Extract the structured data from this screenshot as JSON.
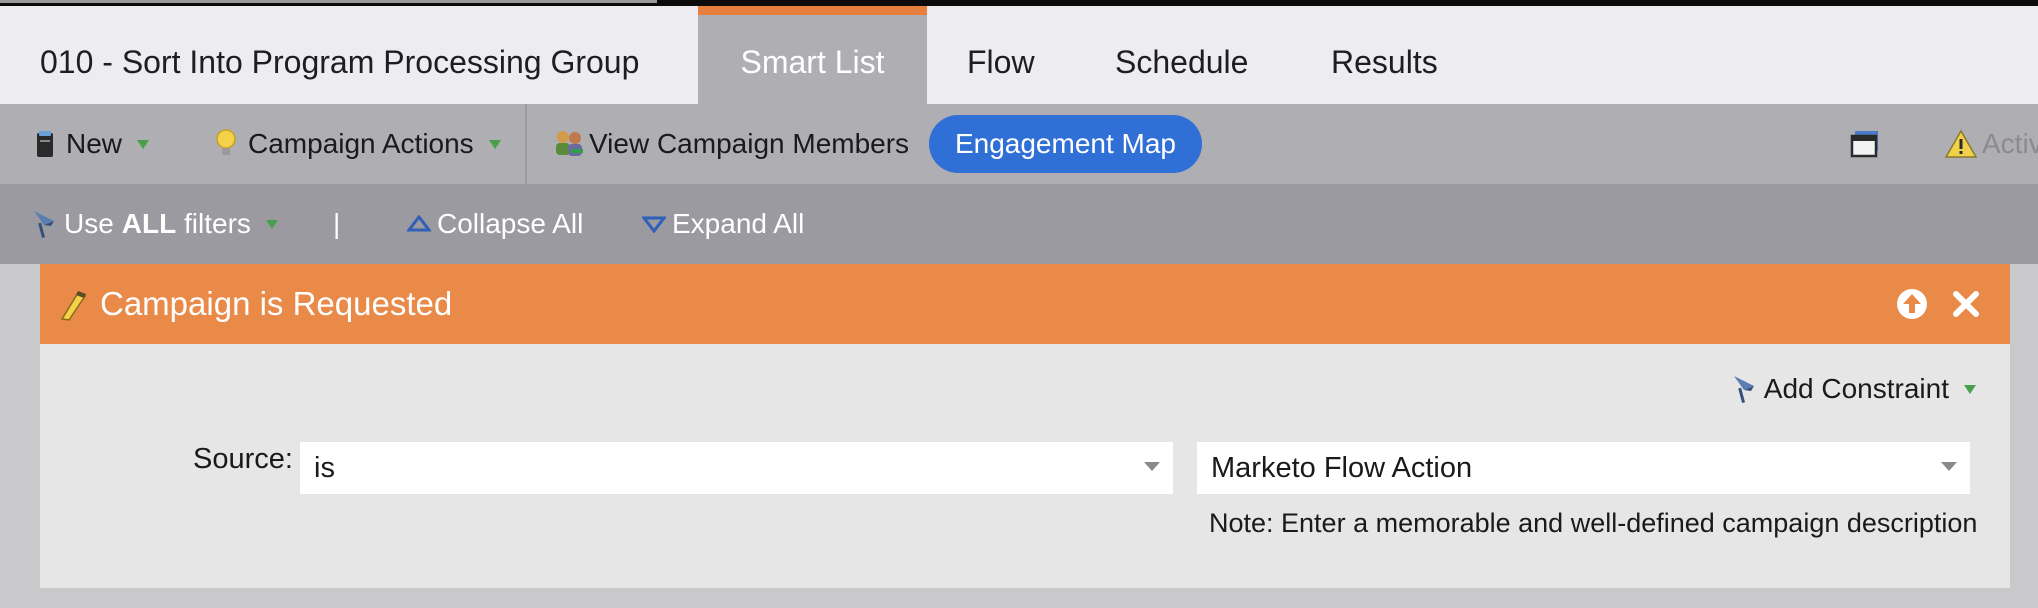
{
  "tabs": {
    "program_name": "010 - Sort Into Program Processing Group",
    "items": [
      "Smart List",
      "Flow",
      "Schedule",
      "Results"
    ],
    "active": "Smart List"
  },
  "toolbar": {
    "new_label": "New",
    "campaign_actions_label": "Campaign Actions",
    "view_members_label": "View Campaign Members",
    "engagement_map_label": "Engagement Map",
    "activate_label": "Activ"
  },
  "filterbar": {
    "use_label_prefix": "Use ",
    "use_label_bold": "ALL",
    "use_label_suffix": " filters",
    "divider": "|",
    "collapse_label": "Collapse All",
    "expand_label": "Expand All"
  },
  "trigger": {
    "title": "Campaign is Requested",
    "add_constraint_label": "Add Constraint",
    "source_label": "Source:",
    "operator_value": "is",
    "source_value": "Marketo Flow Action",
    "note": "Note: Enter a memorable and well-defined campaign description"
  },
  "colors": {
    "accent_orange": "#e8803d",
    "panel_header": "#e98a48",
    "engagement_button": "#2f6fd6",
    "toolbar_bg": "#aeaeb3",
    "filterbar_bg": "#9a9aa0"
  },
  "icons": [
    "new-icon",
    "lightbulb-icon",
    "members-icon",
    "window-icon",
    "warning-icon",
    "filter-funnel-icon",
    "collapse-triangle-icon",
    "expand-triangle-icon",
    "trigger-bolt-icon",
    "move-up-icon",
    "close-icon"
  ]
}
